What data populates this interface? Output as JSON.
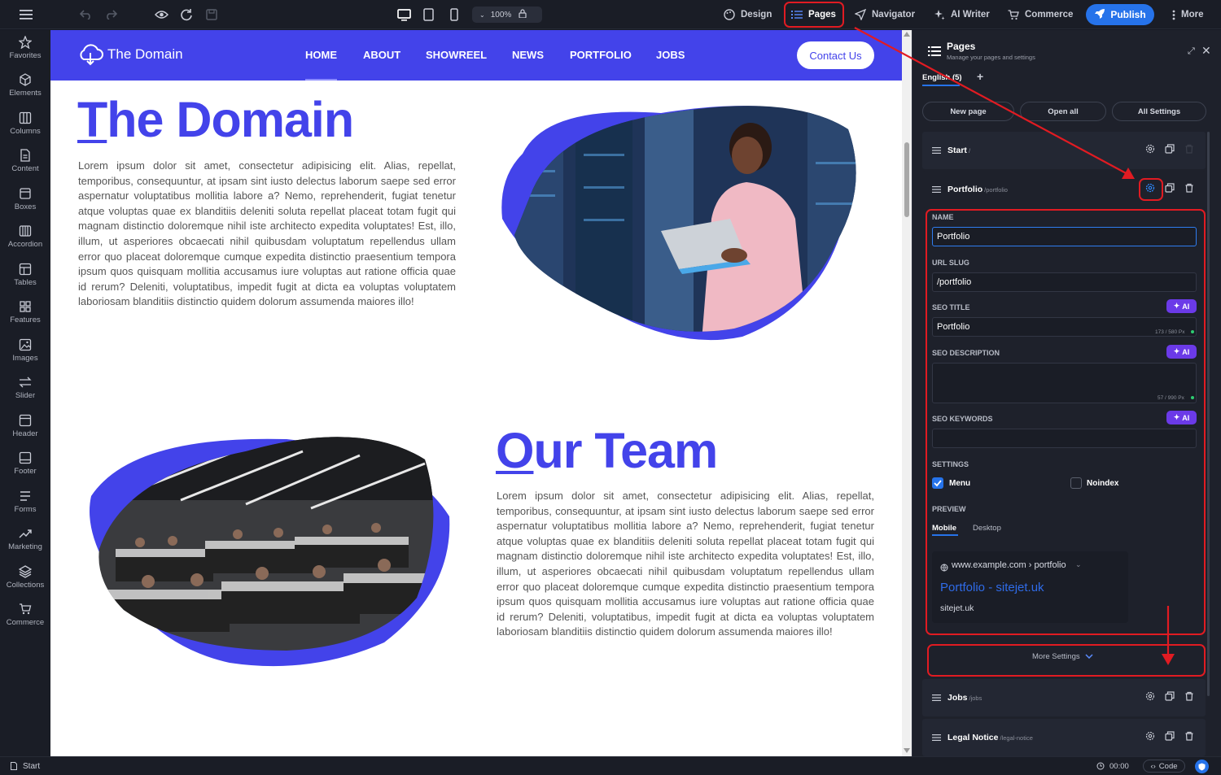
{
  "toolbar": {
    "zoom": "100%",
    "design_label": "Design",
    "pages_label": "Pages",
    "navigator_label": "Navigator",
    "ai_writer_label": "AI Writer",
    "commerce_label": "Commerce",
    "publish_label": "Publish",
    "more_label": "More"
  },
  "sidebar": {
    "items": [
      {
        "label": "Favorites",
        "icon": "star-icon"
      },
      {
        "label": "Elements",
        "icon": "cube-icon"
      },
      {
        "label": "Columns",
        "icon": "columns-icon"
      },
      {
        "label": "Content",
        "icon": "document-icon"
      },
      {
        "label": "Boxes",
        "icon": "box-icon"
      },
      {
        "label": "Accordion",
        "icon": "accordion-icon"
      },
      {
        "label": "Tables",
        "icon": "table-icon"
      },
      {
        "label": "Features",
        "icon": "features-icon"
      },
      {
        "label": "Images",
        "icon": "image-icon"
      },
      {
        "label": "Slider",
        "icon": "slider-icon"
      },
      {
        "label": "Header",
        "icon": "header-icon"
      },
      {
        "label": "Footer",
        "icon": "footer-icon"
      },
      {
        "label": "Forms",
        "icon": "forms-icon"
      },
      {
        "label": "Marketing",
        "icon": "marketing-icon"
      },
      {
        "label": "Collections",
        "icon": "layers-icon"
      },
      {
        "label": "Commerce",
        "icon": "cart-icon"
      }
    ]
  },
  "site": {
    "logo_text": "The Domain",
    "nav": [
      "HOME",
      "ABOUT",
      "SHOWREEL",
      "NEWS",
      "PORTFOLIO",
      "JOBS"
    ],
    "contact_label": "Contact Us",
    "hero_title_first": "T",
    "hero_title_rest": "he Domain",
    "hero_text": "Lorem ipsum dolor sit amet, consectetur adipisicing elit. Alias, repellat, temporibus, consequuntur, at ipsam sint iusto delectus laborum saepe sed error aspernatur voluptatibus mollitia labore a? Nemo, reprehenderit, fugiat tenetur atque voluptas quae ex blanditiis deleniti soluta repellat placeat totam fugit qui magnam distinctio doloremque nihil iste architecto expedita voluptates! Est, illo, illum, ut asperiores obcaecati nihil quibusdam voluptatum repellendus ullam error quo placeat doloremque cumque expedita distinctio praesentium tempora ipsum quos quisquam mollitia accusamus iure voluptas aut ratione officia quae id rerum? Deleniti, voluptatibus, impedit fugit at dicta ea voluptas voluptatem laboriosam blanditiis distinctio quidem dolorum assumenda maiores illo!",
    "team_title_first": "O",
    "team_title_rest": "ur Team",
    "team_text": "Lorem ipsum dolor sit amet, consectetur adipisicing elit. Alias, repellat, temporibus, consequuntur, at ipsam sint iusto delectus laborum saepe sed error aspernatur voluptatibus mollitia labore a? Nemo, reprehenderit, fugiat tenetur atque voluptas quae ex blanditiis deleniti soluta repellat placeat totam fugit qui magnam distinctio doloremque nihil iste architecto expedita voluptates! Est, illo, illum, ut asperiores obcaecati nihil quibusdam voluptatum repellendus ullam error quo placeat doloremque cumque expedita distinctio praesentium tempora ipsum quos quisquam mollitia accusamus iure voluptas aut ratione officia quae id rerum? Deleniti, voluptatibus, impedit fugit at dicta ea voluptas voluptatem laboriosam blanditiis distinctio quidem dolorum assumenda maiores illo!"
  },
  "panel": {
    "title": "Pages",
    "subtitle": "Manage your pages and settings",
    "language_tab": "English (5)",
    "add_label": "+",
    "buttons": {
      "new_page": "New page",
      "open_all": "Open all",
      "all_settings": "All Settings"
    },
    "pages": {
      "start": {
        "name": "Start",
        "slug": "/"
      },
      "portfolio": {
        "name": "Portfolio",
        "slug": "/portfolio"
      },
      "jobs": {
        "name": "Jobs",
        "slug": "/jobs"
      },
      "legal": {
        "name": "Legal Notice",
        "slug": "/legal-notice"
      }
    },
    "form": {
      "name_label": "NAME",
      "name_value": "Portfolio",
      "url_label": "URL SLUG",
      "url_value": "/portfolio",
      "seo_title_label": "SEO TITLE",
      "seo_title_value": "Portfolio",
      "seo_title_counter": "173 / 580 Px",
      "seo_desc_label": "SEO DESCRIPTION",
      "seo_desc_value": "",
      "seo_desc_counter": "57 / 990 Px",
      "seo_keywords_label": "SEO KEYWORDS",
      "seo_keywords_value": "",
      "ai_label": "AI",
      "settings_label": "SETTINGS",
      "menu_label": "Menu",
      "menu_checked": true,
      "noindex_label": "Noindex",
      "noindex_checked": false,
      "preview_label": "PREVIEW",
      "preview_tabs": [
        "Mobile",
        "Desktop"
      ],
      "preview_url": "www.example.com › portfolio",
      "preview_title": "Portfolio - sitejet.uk",
      "preview_site": "sitejet.uk",
      "more_settings": "More Settings"
    }
  },
  "statusbar": {
    "page": "Start",
    "time": "00:00",
    "code_label": "Code"
  },
  "colors": {
    "accent": "#4343ea",
    "publish": "#2673ea",
    "ai": "#6b3ae8",
    "annotation": "#e11b22"
  }
}
